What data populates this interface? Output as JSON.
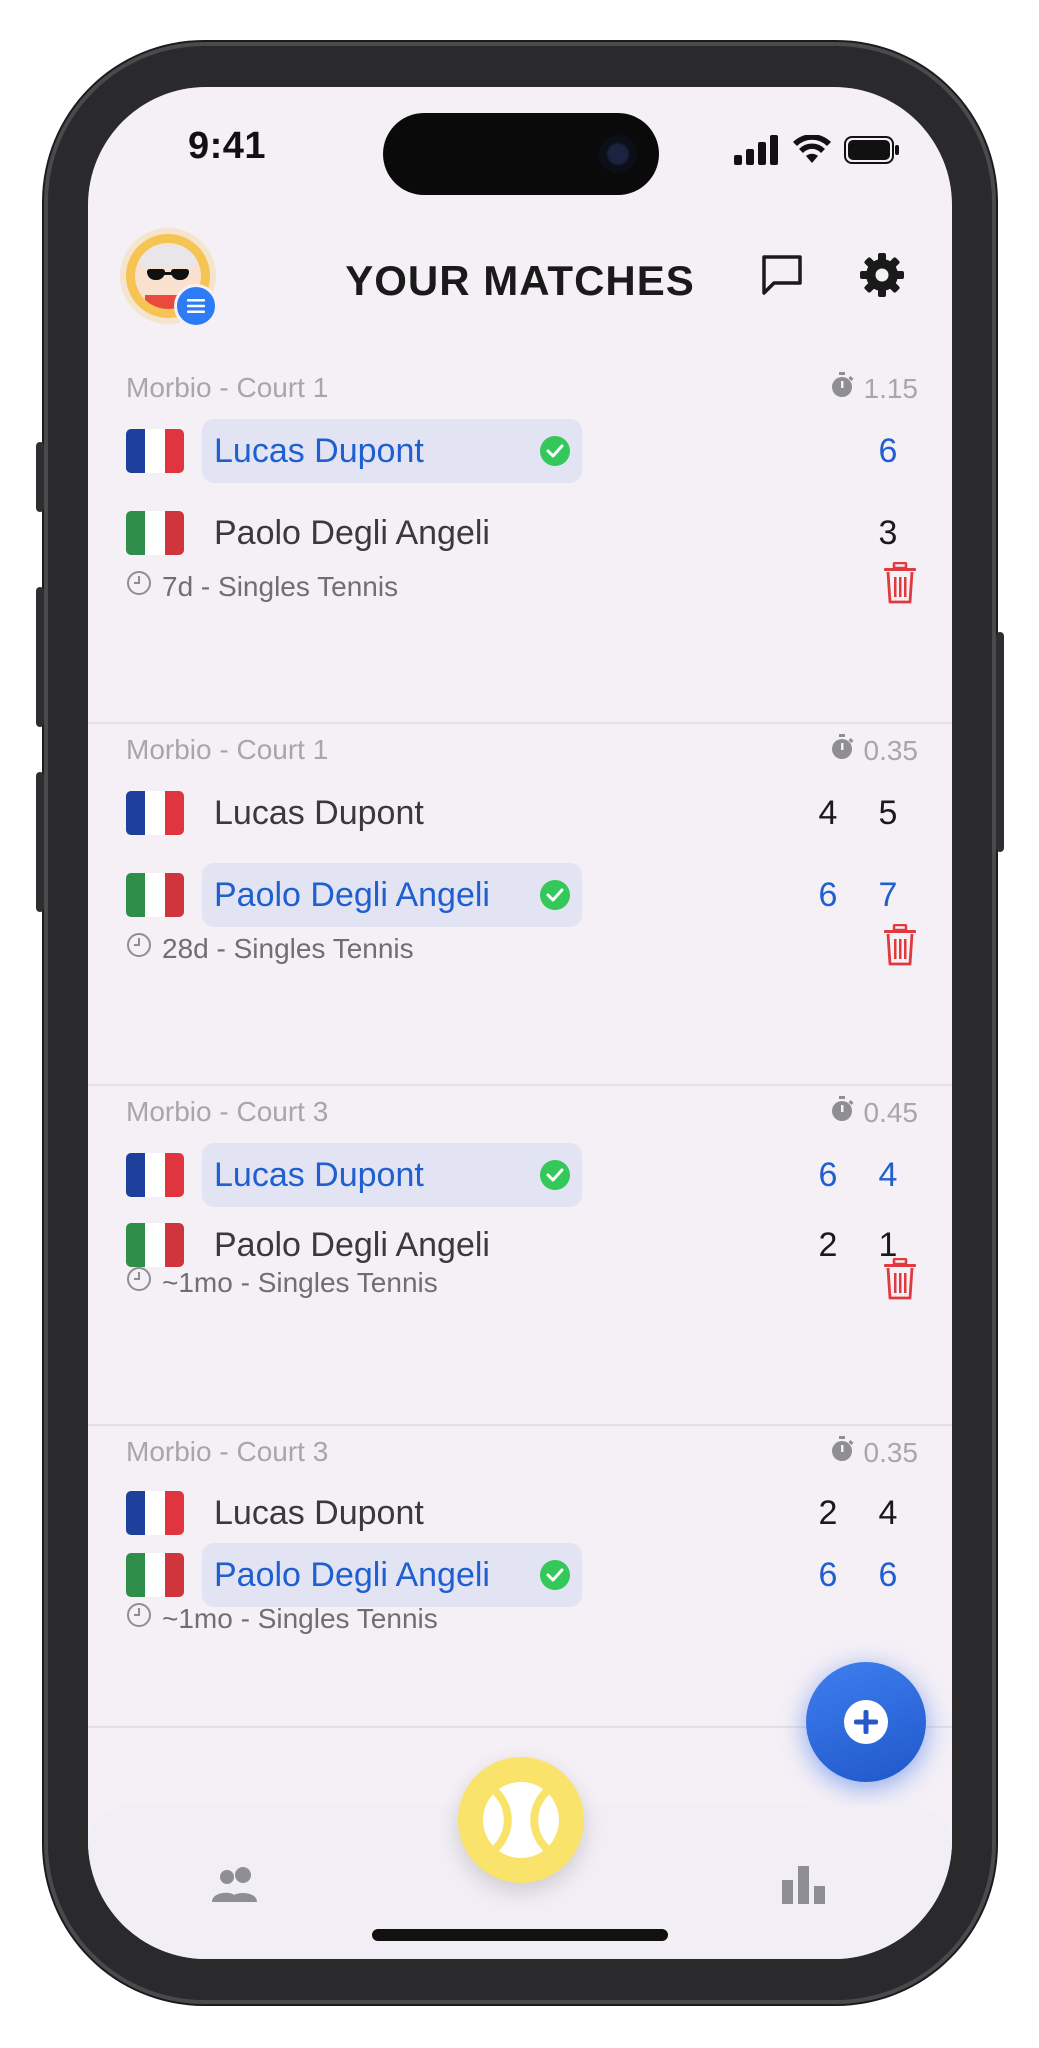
{
  "status_bar": {
    "time": "9:41"
  },
  "header": {
    "title": "YOUR MATCHES"
  },
  "icons": {
    "avatar": "avatar-sunglasses",
    "avatar_badge": "menu-icon",
    "chat": "chat-bubble-icon",
    "settings": "gear-icon",
    "duration": "stopwatch-icon",
    "time": "clock-icon",
    "delete": "trash-icon",
    "add": "plus-icon",
    "players_tab": "people-icon",
    "center_tab": "tennis-ball-icon",
    "stats_tab": "bar-chart-icon"
  },
  "colors": {
    "accent": "#1f5fcf",
    "winner_bg": "#e3e4f3",
    "check": "#34c759",
    "delete": "#e0393e",
    "fab": "#2f6eeb",
    "ball": "#f9e36a"
  },
  "matches": [
    {
      "court": "Morbio - Court 1",
      "duration": "1.15",
      "players": [
        {
          "flag": "France",
          "name": "Lucas Dupont",
          "winner": true,
          "scores": [
            "6"
          ]
        },
        {
          "flag": "Italy",
          "name": "Paolo Degli Angeli",
          "winner": false,
          "scores": [
            "3"
          ]
        }
      ],
      "footer": "7d - Singles Tennis",
      "deletable": true
    },
    {
      "court": "Morbio - Court 1",
      "duration": "0.35",
      "players": [
        {
          "flag": "France",
          "name": "Lucas Dupont",
          "winner": false,
          "scores": [
            "4",
            "5"
          ]
        },
        {
          "flag": "Italy",
          "name": "Paolo Degli Angeli",
          "winner": true,
          "scores": [
            "6",
            "7"
          ]
        }
      ],
      "footer": "28d - Singles Tennis",
      "deletable": true
    },
    {
      "court": "Morbio - Court 3",
      "duration": "0.45",
      "players": [
        {
          "flag": "France",
          "name": "Lucas Dupont",
          "winner": true,
          "scores": [
            "6",
            "4"
          ]
        },
        {
          "flag": "Italy",
          "name": "Paolo Degli Angeli",
          "winner": false,
          "scores": [
            "2",
            "1"
          ]
        }
      ],
      "footer": "~1mo - Singles Tennis",
      "deletable": true
    },
    {
      "court": "Morbio - Court 3",
      "duration": "0.35",
      "players": [
        {
          "flag": "France",
          "name": "Lucas Dupont",
          "winner": false,
          "scores": [
            "2",
            "4"
          ]
        },
        {
          "flag": "Italy",
          "name": "Paolo Degli Angeli",
          "winner": true,
          "scores": [
            "6",
            "6"
          ]
        }
      ],
      "footer": "~1mo - Singles Tennis",
      "deletable": false
    }
  ]
}
